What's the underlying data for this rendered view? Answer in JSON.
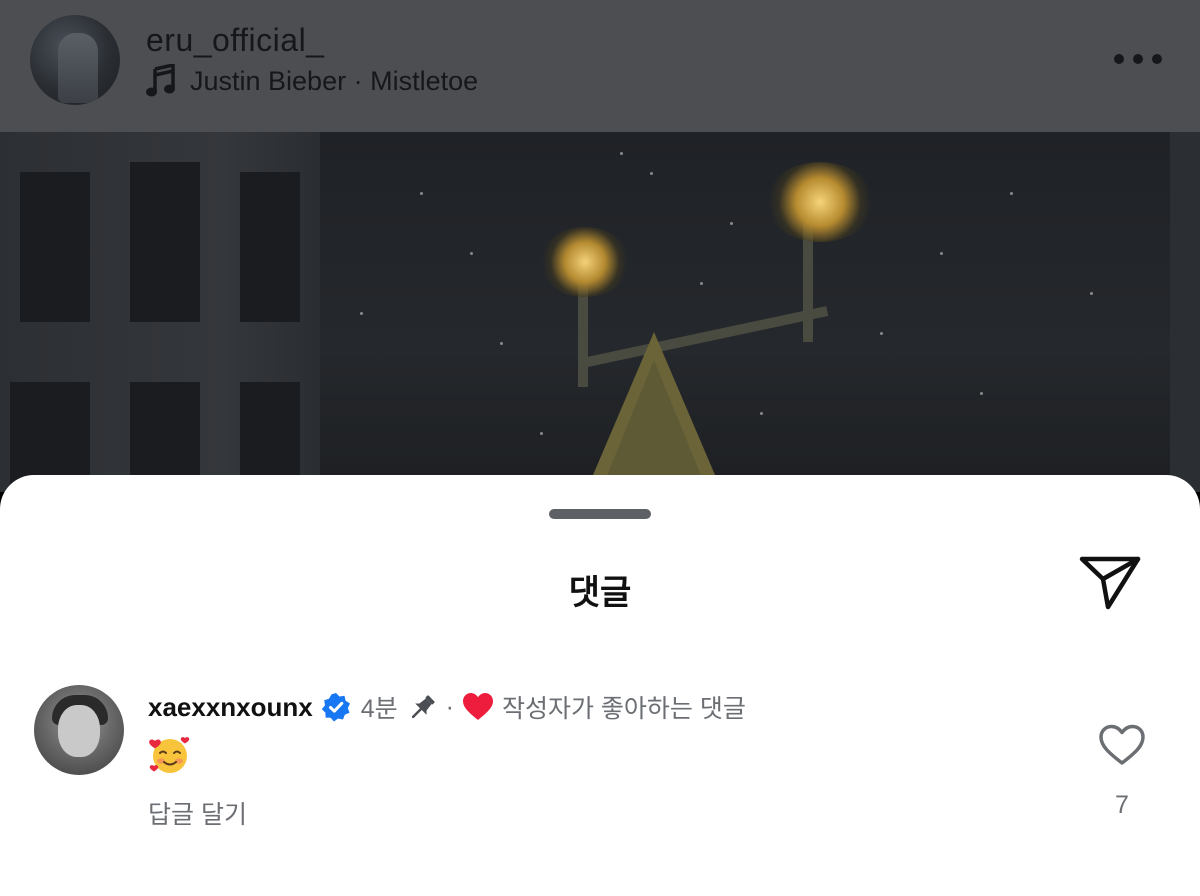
{
  "post": {
    "username": "eru_official_",
    "music": "Justin Bieber · Mistletoe",
    "icons": {
      "music": "music-note-icon",
      "more": "more-horizontal-icon"
    }
  },
  "comments_sheet": {
    "title": "댓글",
    "send_icon": "send-icon",
    "comment": {
      "username": "xaexxnxounx",
      "verified": true,
      "time": "4분",
      "pinned": true,
      "separator": "·",
      "liked_by_author_label": "작성자가 좋아하는 댓글",
      "text": "🥰",
      "reply_label": "답글 달기",
      "like_count": "7"
    }
  },
  "colors": {
    "header_bg": "#4d4e52",
    "sheet_bg": "#ffffff",
    "verified_blue": "#1877f2",
    "heart_red": "#ee1d3d",
    "secondary_text": "#6b6e73"
  }
}
